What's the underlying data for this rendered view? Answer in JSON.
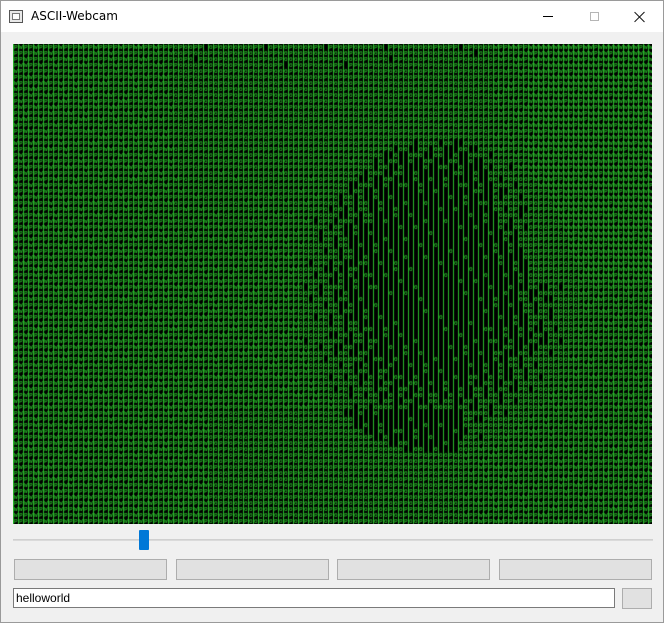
{
  "window": {
    "title": "ASCII-Webcam",
    "icon": "app-window-icon",
    "controls": [
      "minimize-icon",
      "maximize-icon",
      "close-icon"
    ]
  },
  "video": {
    "description_chars": "0PW",
    "foreground_color": "#33dd33",
    "background_color": "#000000"
  },
  "slider": {
    "value_fraction": 0.205
  },
  "buttons": [
    {
      "label": ""
    },
    {
      "label": ""
    },
    {
      "label": ""
    },
    {
      "label": ""
    }
  ],
  "input": {
    "value": "helloworld"
  },
  "send_button": {
    "label": ""
  },
  "colors": {
    "accent": "#0078d7",
    "window_bg": "#f0f0f0"
  }
}
